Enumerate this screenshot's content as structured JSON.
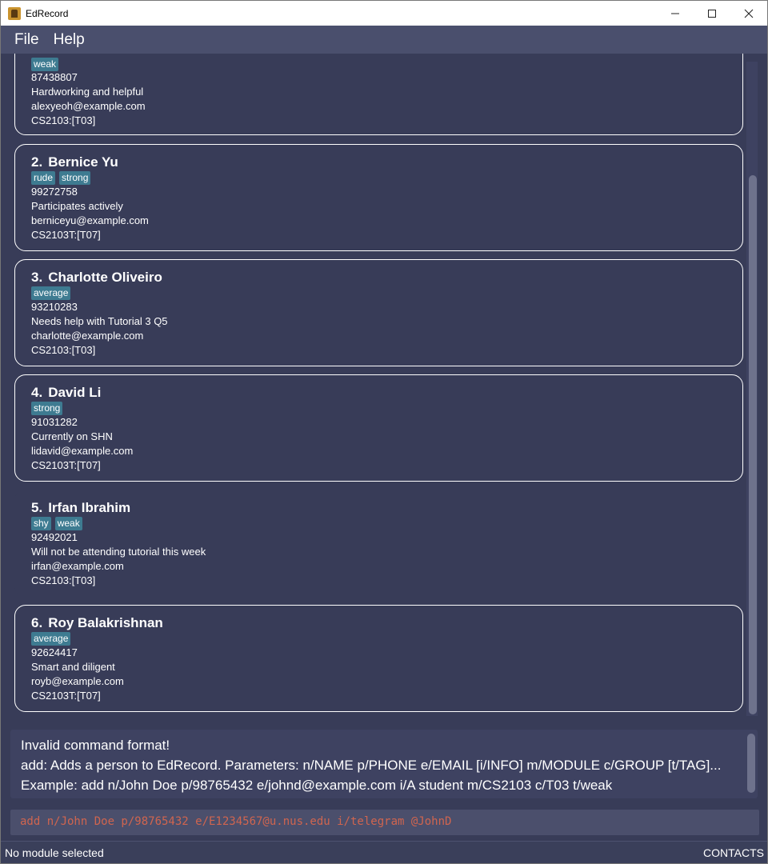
{
  "window": {
    "title": "EdRecord",
    "minimize_icon": "minimize-icon",
    "maximize_icon": "maximize-icon",
    "close_icon": "close-icon"
  },
  "menu": {
    "file": "File",
    "help": "Help"
  },
  "persons": [
    {
      "index": "",
      "name": "",
      "tags": [
        "weak"
      ],
      "phone": "87438807",
      "info": "Hardworking and helpful",
      "email": "alexyeoh@example.com",
      "module": "CS2103:[T03]"
    },
    {
      "index": "2.",
      "name": "Bernice Yu",
      "tags": [
        "rude",
        "strong"
      ],
      "phone": "99272758",
      "info": "Participates actively",
      "email": "berniceyu@example.com",
      "module": "CS2103T:[T07]"
    },
    {
      "index": "3.",
      "name": "Charlotte Oliveiro",
      "tags": [
        "average"
      ],
      "phone": "93210283",
      "info": "Needs help with Tutorial 3 Q5",
      "email": "charlotte@example.com",
      "module": "CS2103:[T03]"
    },
    {
      "index": "4.",
      "name": "David Li",
      "tags": [
        "strong"
      ],
      "phone": "91031282",
      "info": "Currently on SHN",
      "email": "lidavid@example.com",
      "module": "CS2103T:[T07]"
    },
    {
      "index": "5.",
      "name": "Irfan Ibrahim",
      "tags": [
        "shy",
        "weak"
      ],
      "phone": "92492021",
      "info": "Will not be attending tutorial this week",
      "email": "irfan@example.com",
      "module": "CS2103:[T03]"
    },
    {
      "index": "6.",
      "name": "Roy Balakrishnan",
      "tags": [
        "average"
      ],
      "phone": "92624417",
      "info": "Smart and diligent",
      "email": "royb@example.com",
      "module": "CS2103T:[T07]"
    }
  ],
  "result": {
    "line1": "Invalid command format!",
    "line2": "add: Adds a person to EdRecord. Parameters: n/NAME p/PHONE e/EMAIL [i/INFO] m/MODULE c/GROUP [t/TAG]...",
    "line3": "Example: add n/John Doe p/98765432 e/johnd@example.com i/A student m/CS2103 c/T03 t/weak"
  },
  "command": {
    "value": "add n/John Doe p/98765432 e/E1234567@u.nus.edu i/telegram @JohnD"
  },
  "status": {
    "module": "No module selected",
    "view": "CONTACTS"
  },
  "colors": {
    "background": "#383c58",
    "tag": "#3e7b91",
    "command_text": "#d0654f"
  }
}
